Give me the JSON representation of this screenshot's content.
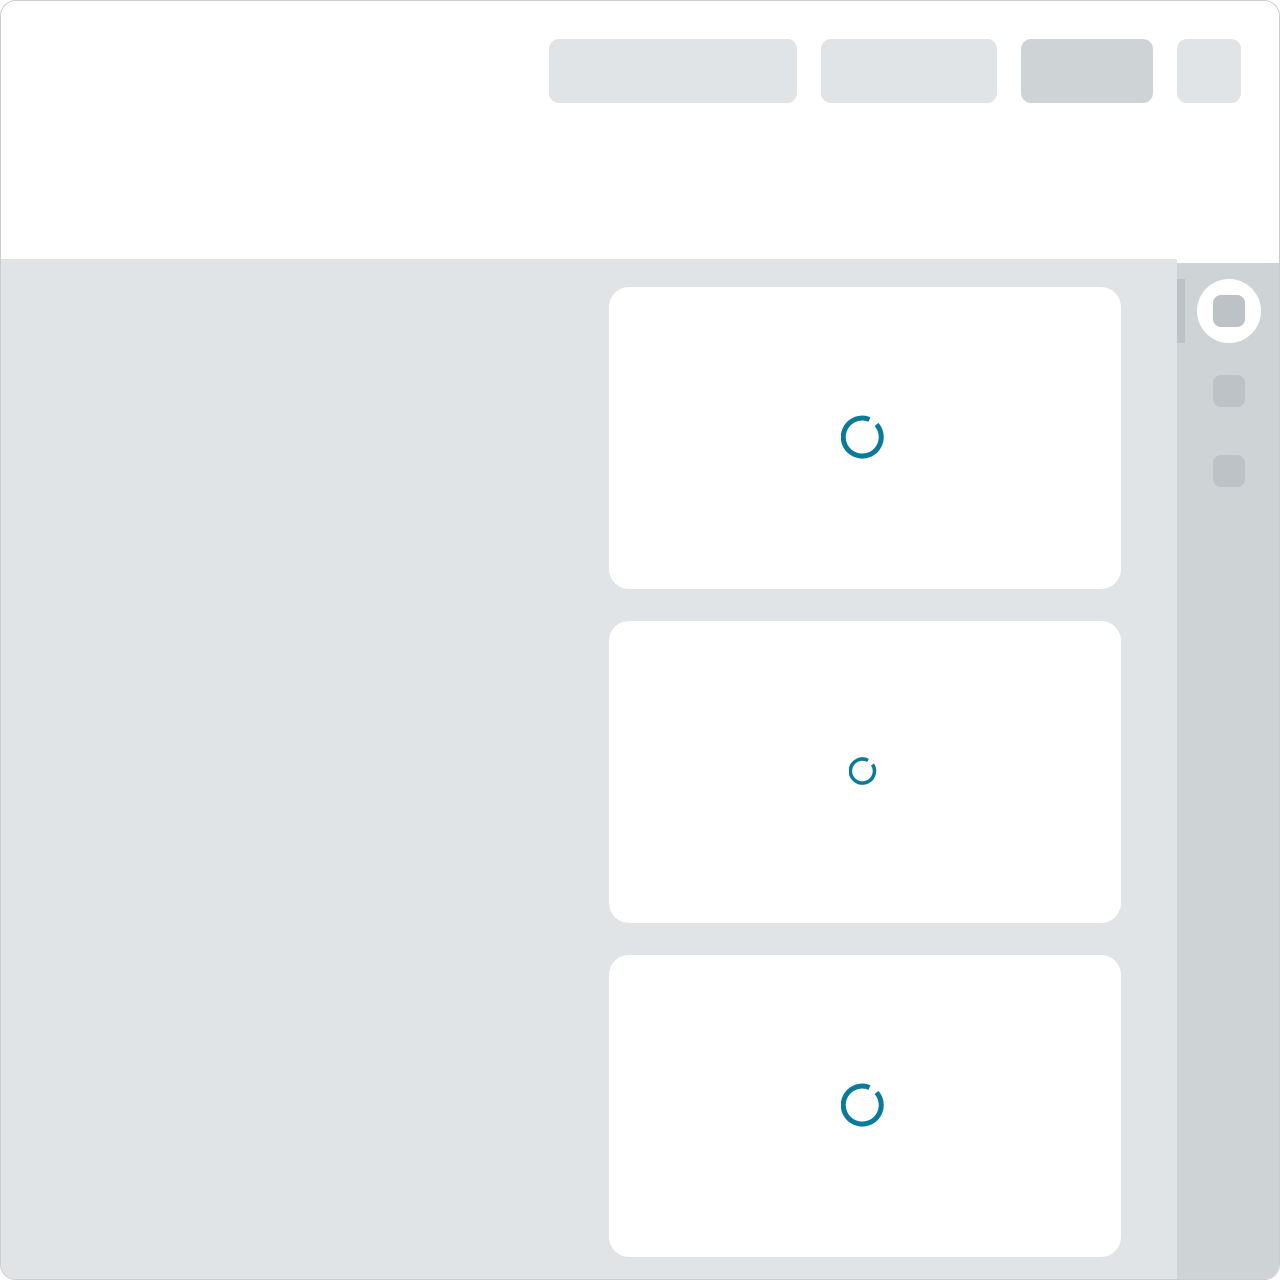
{
  "theme": {
    "accent": "#0a7a9a",
    "page_background": "#e0e4e7",
    "card_background": "#ffffff",
    "skeleton_light": "#e0e4e7",
    "skeleton_dark": "#ced3d6",
    "rail_background": "#ced3d6",
    "rail_item": "#bcc2c6"
  },
  "header": {
    "placeholders": [
      {
        "name": "skeleton-pill-1"
      },
      {
        "name": "skeleton-pill-2"
      },
      {
        "name": "skeleton-pill-3",
        "state": "highlighted"
      },
      {
        "name": "skeleton-pill-4"
      }
    ]
  },
  "main": {
    "cards": [
      {
        "state": "loading",
        "icon": "spinner-icon"
      },
      {
        "state": "loading",
        "icon": "spinner-icon"
      },
      {
        "state": "loading",
        "icon": "spinner-icon"
      }
    ]
  },
  "rail": {
    "items": [
      {
        "icon": "rail-item-icon",
        "active": true
      },
      {
        "icon": "rail-item-icon",
        "active": false
      },
      {
        "icon": "rail-item-icon",
        "active": false
      }
    ]
  }
}
